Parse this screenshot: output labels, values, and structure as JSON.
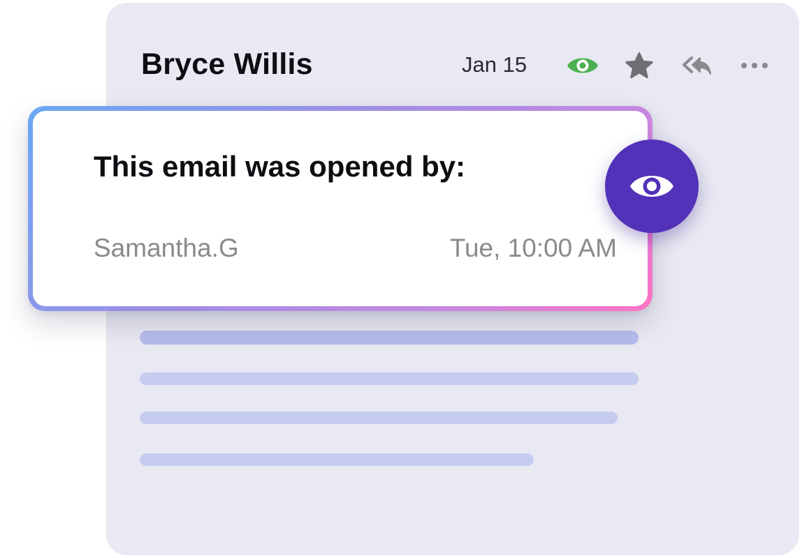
{
  "email": {
    "sender": "Bryce Willis",
    "date": "Jan 15",
    "actions": [
      {
        "icon": "eye-icon",
        "color": "#4caf50"
      },
      {
        "icon": "star-icon",
        "color": "#6e6e73"
      },
      {
        "icon": "reply-all-icon",
        "color": "#8a8a8e"
      },
      {
        "icon": "more-icon",
        "color": "#8a8a8e"
      }
    ]
  },
  "popup": {
    "title": "This email was opened by:",
    "opener": "Samantha.G",
    "time": "Tue, 10:00 AM",
    "badge_icon": "eye-icon",
    "badge_color": "#5232b8"
  }
}
